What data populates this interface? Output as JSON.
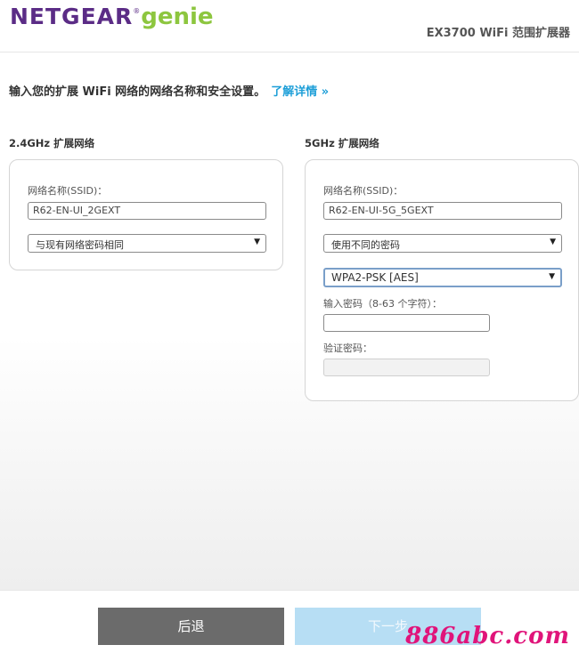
{
  "header": {
    "logo_brand": "NETGEAR",
    "logo_reg": "®",
    "logo_product": "genie",
    "product_title": "EX3700 WiFi 范围扩展器"
  },
  "intro": {
    "text": "输入您的扩展 WiFi 网络的网络名称和安全设置。",
    "link": "了解详情 »"
  },
  "band24": {
    "title": "2.4GHz 扩展网络",
    "ssid_label": "网络名称(SSID)：",
    "ssid_value": "R62-EN-UI_2GEXT",
    "password_mode": "与现有网络密码相同"
  },
  "band5": {
    "title": "5GHz 扩展网络",
    "ssid_label": "网络名称(SSID)：",
    "ssid_value": "R62-EN-UI-5G_5GEXT",
    "password_mode": "使用不同的密码",
    "security": "WPA2-PSK [AES]",
    "password_label": "输入密码（8-63 个字符）：",
    "password_value": "",
    "verify_label": "验证密码：",
    "verify_value": ""
  },
  "footer": {
    "back_label": "后退",
    "next_label": "下一步",
    "watermark": "886abc.com"
  },
  "colors": {
    "brand_purple": "#5b2c86",
    "genie_green": "#8dc63f",
    "link_blue": "#1e9fd8",
    "back_button": "#6b6b6b",
    "next_button_disabled": "#b7def4",
    "watermark": "#e0147a"
  },
  "icons": {
    "dropdown": "triangle-down-icon"
  }
}
